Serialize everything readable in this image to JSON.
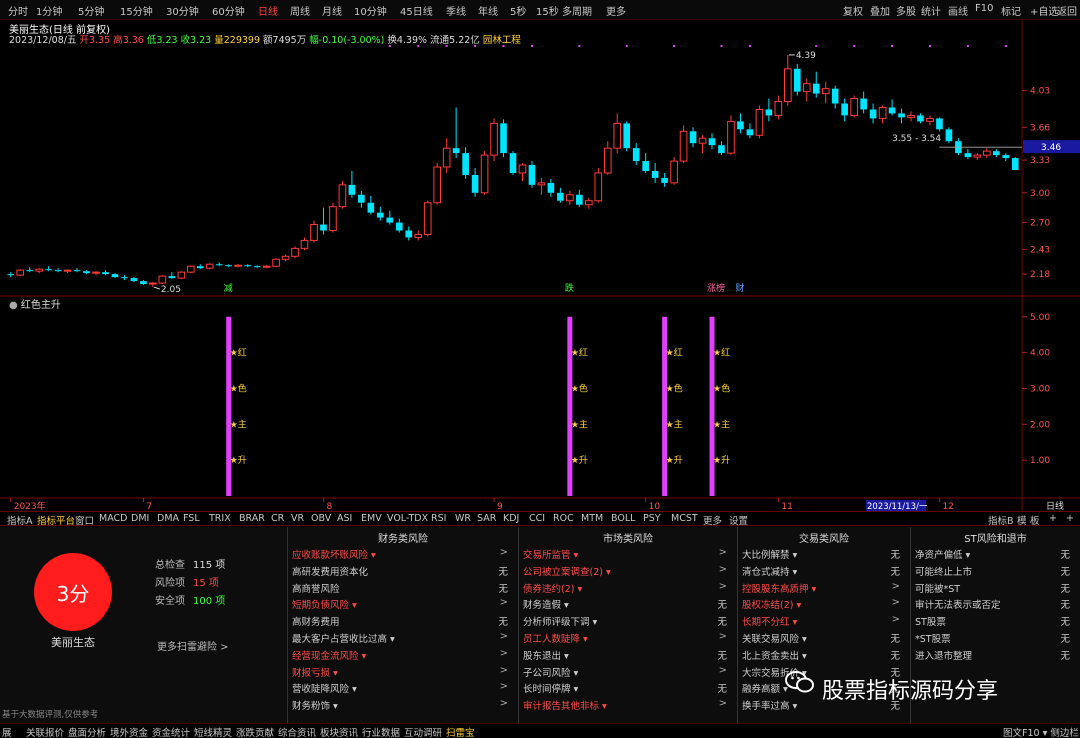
{
  "periods": [
    "分时",
    "1分钟",
    "5分钟",
    "15分钟",
    "30分钟",
    "60分钟",
    "日线",
    "周线",
    "月线",
    "10分钟",
    "45日线",
    "季线",
    "年线",
    "5秒",
    "15秒",
    "多周期",
    "更多"
  ],
  "active_period": "日线",
  "top_right": [
    "复权",
    "叠加",
    "多股",
    "统计",
    "画线",
    "F10",
    "标记",
    "+自选",
    "返回"
  ],
  "title": "美丽生态(日线 前复权)",
  "quote": {
    "date": "2023/12/08/五",
    "open": "开3.35",
    "high": "高3.36",
    "low": "低3.23",
    "close": "收3.23",
    "vol": "量229399",
    "amount": "额7495万",
    "chg": "幅-0.10(-3.00%)",
    "turnover": "换4.39%",
    "float": "流通5.22亿",
    "sector": "园林工程"
  },
  "chart_data": {
    "type": "candlestick",
    "ohlc": [
      [
        2.18,
        2.2,
        2.15,
        2.17
      ],
      [
        2.17,
        2.23,
        2.16,
        2.22
      ],
      [
        2.22,
        2.25,
        2.2,
        2.21
      ],
      [
        2.21,
        2.24,
        2.19,
        2.23
      ],
      [
        2.23,
        2.26,
        2.21,
        2.22
      ],
      [
        2.22,
        2.24,
        2.2,
        2.21
      ],
      [
        2.21,
        2.23,
        2.19,
        2.22
      ],
      [
        2.22,
        2.24,
        2.2,
        2.21
      ],
      [
        2.21,
        2.22,
        2.18,
        2.19
      ],
      [
        2.19,
        2.21,
        2.17,
        2.2
      ],
      [
        2.2,
        2.22,
        2.17,
        2.18
      ],
      [
        2.18,
        2.19,
        2.14,
        2.15
      ],
      [
        2.15,
        2.17,
        2.12,
        2.14
      ],
      [
        2.14,
        2.15,
        2.1,
        2.11
      ],
      [
        2.11,
        2.12,
        2.07,
        2.08
      ],
      [
        2.08,
        2.1,
        2.05,
        2.09
      ],
      [
        2.09,
        2.17,
        2.08,
        2.16
      ],
      [
        2.16,
        2.2,
        2.13,
        2.14
      ],
      [
        2.14,
        2.21,
        2.13,
        2.2
      ],
      [
        2.2,
        2.27,
        2.19,
        2.26
      ],
      [
        2.26,
        2.28,
        2.23,
        2.24
      ],
      [
        2.24,
        2.29,
        2.23,
        2.28
      ],
      [
        2.28,
        2.3,
        2.26,
        2.27
      ],
      [
        2.27,
        2.28,
        2.25,
        2.26
      ],
      [
        2.26,
        2.28,
        2.25,
        2.27
      ],
      [
        2.27,
        2.28,
        2.25,
        2.26
      ],
      [
        2.26,
        2.27,
        2.24,
        2.25
      ],
      [
        2.25,
        2.27,
        2.24,
        2.26
      ],
      [
        2.26,
        2.34,
        2.25,
        2.33
      ],
      [
        2.33,
        2.38,
        2.31,
        2.36
      ],
      [
        2.36,
        2.46,
        2.34,
        2.44
      ],
      [
        2.44,
        2.55,
        2.42,
        2.52
      ],
      [
        2.52,
        2.72,
        2.5,
        2.68
      ],
      [
        2.68,
        2.85,
        2.58,
        2.62
      ],
      [
        2.62,
        2.9,
        2.6,
        2.86
      ],
      [
        2.86,
        3.12,
        2.84,
        3.08
      ],
      [
        3.08,
        3.22,
        2.95,
        2.98
      ],
      [
        2.98,
        3.02,
        2.85,
        2.9
      ],
      [
        2.9,
        2.97,
        2.78,
        2.8
      ],
      [
        2.8,
        2.86,
        2.72,
        2.75
      ],
      [
        2.75,
        2.82,
        2.68,
        2.7
      ],
      [
        2.7,
        2.74,
        2.6,
        2.62
      ],
      [
        2.62,
        2.66,
        2.52,
        2.55
      ],
      [
        2.55,
        2.62,
        2.52,
        2.58
      ],
      [
        2.58,
        2.92,
        2.56,
        2.9
      ],
      [
        2.9,
        3.3,
        2.88,
        3.26
      ],
      [
        3.26,
        3.55,
        3.2,
        3.45
      ],
      [
        3.45,
        3.86,
        3.35,
        3.4
      ],
      [
        3.4,
        3.46,
        3.14,
        3.18
      ],
      [
        3.18,
        3.25,
        2.96,
        3.0
      ],
      [
        3.0,
        3.42,
        2.98,
        3.38
      ],
      [
        3.38,
        3.75,
        3.32,
        3.7
      ],
      [
        3.7,
        3.74,
        3.36,
        3.4
      ],
      [
        3.4,
        3.42,
        3.18,
        3.2
      ],
      [
        3.2,
        3.3,
        3.12,
        3.28
      ],
      [
        3.28,
        3.32,
        3.05,
        3.08
      ],
      [
        3.08,
        3.15,
        2.98,
        3.1
      ],
      [
        3.1,
        3.14,
        2.96,
        3.0
      ],
      [
        3.0,
        3.05,
        2.9,
        2.92
      ],
      [
        2.92,
        3.02,
        2.88,
        2.98
      ],
      [
        2.98,
        3.03,
        2.86,
        2.88
      ],
      [
        2.88,
        2.95,
        2.84,
        2.92
      ],
      [
        2.92,
        3.25,
        2.9,
        3.2
      ],
      [
        3.2,
        3.52,
        3.18,
        3.45
      ],
      [
        3.45,
        3.8,
        3.4,
        3.7
      ],
      [
        3.7,
        3.72,
        3.42,
        3.45
      ],
      [
        3.45,
        3.5,
        3.28,
        3.32
      ],
      [
        3.32,
        3.4,
        3.2,
        3.22
      ],
      [
        3.22,
        3.3,
        3.1,
        3.15
      ],
      [
        3.15,
        3.2,
        3.06,
        3.1
      ],
      [
        3.1,
        3.36,
        3.08,
        3.32
      ],
      [
        3.32,
        3.68,
        3.3,
        3.62
      ],
      [
        3.62,
        3.66,
        3.46,
        3.5
      ],
      [
        3.5,
        3.58,
        3.4,
        3.55
      ],
      [
        3.55,
        3.6,
        3.44,
        3.48
      ],
      [
        3.48,
        3.52,
        3.38,
        3.4
      ],
      [
        3.4,
        3.78,
        3.38,
        3.72
      ],
      [
        3.72,
        3.8,
        3.6,
        3.64
      ],
      [
        3.64,
        3.7,
        3.55,
        3.58
      ],
      [
        3.58,
        3.88,
        3.55,
        3.84
      ],
      [
        3.84,
        3.95,
        3.72,
        3.78
      ],
      [
        3.78,
        3.98,
        3.74,
        3.92
      ],
      [
        3.92,
        4.39,
        3.88,
        4.25
      ],
      [
        4.25,
        4.3,
        3.98,
        4.02
      ],
      [
        4.02,
        4.15,
        3.92,
        4.1
      ],
      [
        4.1,
        4.22,
        3.96,
        4.0
      ],
      [
        4.0,
        4.12,
        3.9,
        4.05
      ],
      [
        4.05,
        4.08,
        3.85,
        3.9
      ],
      [
        3.9,
        3.95,
        3.72,
        3.78
      ],
      [
        3.78,
        3.98,
        3.76,
        3.95
      ],
      [
        3.95,
        4.02,
        3.8,
        3.84
      ],
      [
        3.84,
        3.9,
        3.7,
        3.75
      ],
      [
        3.75,
        3.88,
        3.7,
        3.86
      ],
      [
        3.86,
        3.94,
        3.78,
        3.8
      ],
      [
        3.8,
        3.85,
        3.7,
        3.76
      ],
      [
        3.76,
        3.82,
        3.72,
        3.78
      ],
      [
        3.78,
        3.8,
        3.7,
        3.72
      ],
      [
        3.72,
        3.78,
        3.68,
        3.75
      ],
      [
        3.75,
        3.76,
        3.62,
        3.64
      ],
      [
        3.64,
        3.66,
        3.5,
        3.52
      ],
      [
        3.52,
        3.55,
        3.38,
        3.4
      ],
      [
        3.4,
        3.44,
        3.34,
        3.36
      ],
      [
        3.36,
        3.4,
        3.33,
        3.38
      ],
      [
        3.38,
        3.45,
        3.35,
        3.42
      ],
      [
        3.42,
        3.44,
        3.36,
        3.38
      ],
      [
        3.38,
        3.4,
        3.32,
        3.35
      ],
      [
        3.35,
        3.36,
        3.23,
        3.23
      ]
    ],
    "y_ticks": [
      "4.03",
      "3.66",
      "3.33",
      "3.00",
      "2.70",
      "2.43",
      "2.18"
    ],
    "ylim": [
      2.0,
      4.5
    ],
    "last_price": "3.46",
    "high_mark": "4.39",
    "low_mark": "2.05",
    "range_label": "3.55 - 3.54",
    "event_markers": [
      "减",
      "跌",
      "涨榜",
      "财"
    ],
    "x_labels": [
      "2023年",
      "7",
      "8",
      "9",
      "10",
      "11",
      "12"
    ],
    "cursor_date": "2023/11/13/一",
    "cursor_level": 3.46,
    "range_level": 3.55,
    "signal_bars": [
      23,
      59,
      69,
      74
    ],
    "signal_top": 5.0,
    "signal_labels": [
      "★红",
      "★色",
      "★主",
      "★升"
    ],
    "sub_ticks": [
      "5.00",
      "4.00",
      "3.00",
      "2.00",
      "1.00"
    ],
    "sub_ylim": [
      0,
      5.3
    ]
  },
  "sub_title": "红色主升",
  "period_label": "日线",
  "indicator_tabs": [
    "指标A",
    "指标平台",
    "窗口",
    "MACD",
    "DMI",
    "DMA",
    "FSL",
    "TRIX",
    "BRAR",
    "CR",
    "VR",
    "OBV",
    "ASI",
    "EMV",
    "VOL-TDX",
    "RSI",
    "WR",
    "SAR",
    "KDJ",
    "CCI",
    "ROC",
    "MTM",
    "BOLL",
    "PSY",
    "MCST",
    "更多",
    "设置"
  ],
  "active_indicator": "指标平台",
  "indicator_right": [
    "指标B",
    "模",
    "板",
    "+",
    "+"
  ],
  "risk": {
    "score": "3分",
    "stock": "美丽生态",
    "stats": [
      {
        "label": "总检查",
        "value": "115 项"
      },
      {
        "label": "风险项",
        "value": "15 项"
      },
      {
        "label": "安全项",
        "value": "100 项"
      }
    ],
    "more": "更多扫雷避险 >",
    "footnote": "基于大数据评测,仅供参考",
    "columns": [
      {
        "title": "财务类风险",
        "items": [
          {
            "t": "应收账款坏账风险 ▾",
            "v": ">",
            "red": true
          },
          {
            "t": "高研发费用资本化",
            "v": "无"
          },
          {
            "t": "高商誉风险",
            "v": "无"
          },
          {
            "t": "短期负债风险 ▾",
            "v": ">",
            "red": true
          },
          {
            "t": "高财务费用",
            "v": "无"
          },
          {
            "t": "最大客户占营收比过高 ▾",
            "v": ">"
          },
          {
            "t": "经营现金流风险 ▾",
            "v": ">",
            "red": true
          },
          {
            "t": "财报亏损 ▾",
            "v": ">",
            "red": true
          },
          {
            "t": "营收陡降风险 ▾",
            "v": ">"
          },
          {
            "t": "财务粉饰 ▾",
            "v": ">"
          }
        ]
      },
      {
        "title": "市场类风险",
        "items": [
          {
            "t": "交易所监管 ▾",
            "v": ">",
            "red": true
          },
          {
            "t": "公司被立案调查(2) ▾",
            "v": ">",
            "red": true
          },
          {
            "t": "债券违约(2) ▾",
            "v": ">",
            "red": true
          },
          {
            "t": "财务造假 ▾",
            "v": "无"
          },
          {
            "t": "分析师评级下调 ▾",
            "v": "无"
          },
          {
            "t": "员工人数陡降 ▾",
            "v": ">",
            "red": true
          },
          {
            "t": "股东退出 ▾",
            "v": "无"
          },
          {
            "t": "子公司风险 ▾",
            "v": ">"
          },
          {
            "t": "长时间停牌 ▾",
            "v": "无"
          },
          {
            "t": "审计报告其他非标 ▾",
            "v": ">",
            "red": true
          }
        ]
      },
      {
        "title": "交易类风险",
        "items": [
          {
            "t": "大比例解禁 ▾",
            "v": "无"
          },
          {
            "t": "清仓式减持 ▾",
            "v": "无"
          },
          {
            "t": "控股股东高质押 ▾",
            "v": ">",
            "red": true
          },
          {
            "t": "股权冻结(2) ▾",
            "v": ">",
            "red": true
          },
          {
            "t": "长期不分红 ▾",
            "v": ">",
            "red": true
          },
          {
            "t": "关联交易风险 ▾",
            "v": "无"
          },
          {
            "t": "北上资金卖出 ▾",
            "v": "无"
          },
          {
            "t": "大宗交易折价 ▾",
            "v": "无"
          },
          {
            "t": "融券高额 ▾",
            "v": "无"
          },
          {
            "t": "换手率过高 ▾",
            "v": "无"
          }
        ]
      },
      {
        "title": "ST风险和退市",
        "items": [
          {
            "t": "净资产偏低 ▾",
            "v": "无"
          },
          {
            "t": "可能终止上市",
            "v": "无"
          },
          {
            "t": "可能被*ST",
            "v": "无"
          },
          {
            "t": "审计无法表示或否定",
            "v": "无"
          },
          {
            "t": "ST股票",
            "v": "无"
          },
          {
            "t": "*ST股票",
            "v": "无"
          },
          {
            "t": "进入退市整理",
            "v": "无"
          }
        ]
      }
    ]
  },
  "watermark": "股票指标源码分享",
  "bottom_tabs": [
    "展",
    "关联报价",
    "盘面分析",
    "境外资金",
    "资金统计",
    "短线精灵",
    "涨跌贡献",
    "综合资讯",
    "板块资讯",
    "行业数据",
    "互动调研",
    "扫雷宝"
  ],
  "active_bottom": "扫雷宝",
  "bottom_right": "图文F10 ▾ 侧边栏 »",
  "colors": {
    "up": "#ff3a3a",
    "down": "#00e5ff",
    "signal": "#e040fb",
    "accent": "#ffd23a"
  }
}
